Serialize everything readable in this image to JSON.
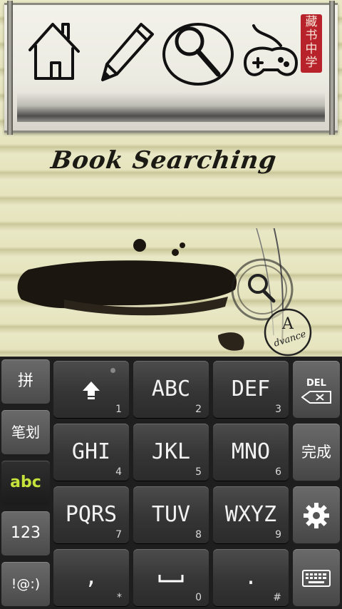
{
  "app": {
    "title": "Book Searching",
    "seal_text": "藏书中学",
    "nav": [
      "home-icon",
      "pencil-icon",
      "search-icon",
      "gamepad-icon"
    ],
    "search_badge_icon": "search-icon",
    "advanced_badge": {
      "letter": "A",
      "word": "dvance"
    }
  },
  "keyboard": {
    "side_keys": [
      "拼",
      "笔划",
      "abc",
      "123",
      "!@:)"
    ],
    "active_side": "abc",
    "keys": [
      {
        "label": "",
        "icon": "shift-arrow-icon",
        "sub": "1"
      },
      {
        "label": "ABC",
        "sub": "2"
      },
      {
        "label": "DEF",
        "sub": "3"
      },
      {
        "label": "GHI",
        "sub": "4"
      },
      {
        "label": "JKL",
        "sub": "5"
      },
      {
        "label": "MNO",
        "sub": "6"
      },
      {
        "label": "PQRS",
        "sub": "7"
      },
      {
        "label": "TUV",
        "sub": "8"
      },
      {
        "label": "WXYZ",
        "sub": "9"
      },
      {
        "label": ",",
        "sub": "*"
      },
      {
        "label": "",
        "icon": "space-icon",
        "sub": "0"
      },
      {
        "label": ".",
        "sub": "#"
      }
    ],
    "right_keys": {
      "delete_label": "DEL",
      "done_label": "完成",
      "settings_icon": "gear-icon",
      "hide_icon": "keyboard-icon"
    }
  }
}
